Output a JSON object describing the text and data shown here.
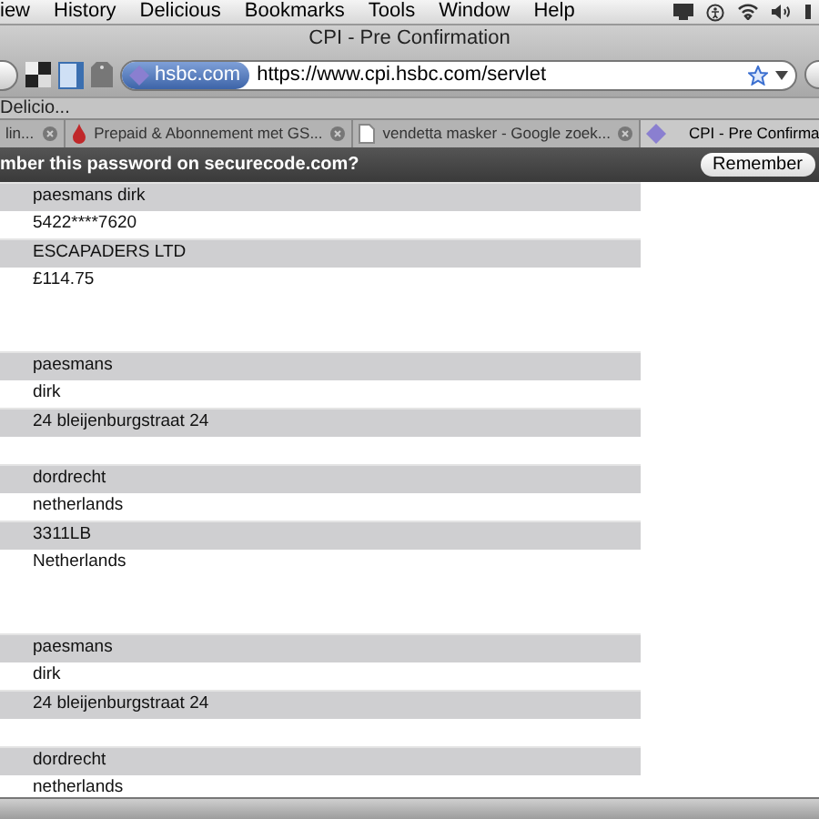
{
  "menu_bar": {
    "items": [
      "iew",
      "History",
      "Delicious",
      "Bookmarks",
      "Tools",
      "Window",
      "Help"
    ]
  },
  "window": {
    "title": "CPI - Pre Confirmation"
  },
  "toolbar": {
    "site_badge": "hsbc.com",
    "url": "https://www.cpi.hsbc.com/servlet"
  },
  "bookmarks_bar": {
    "items": [
      "Delicio..."
    ]
  },
  "tabs": [
    {
      "label": "lin...",
      "selected": false,
      "kind": "none"
    },
    {
      "label": "Prepaid & Abonnement met GS...",
      "selected": false,
      "kind": "drop"
    },
    {
      "label": "vendetta masker - Google zoek...",
      "selected": false,
      "kind": "page"
    },
    {
      "label": "CPI - Pre Confirma",
      "selected": true,
      "kind": "diamond"
    }
  ],
  "notification": {
    "message": "mber this password on securecode.com?",
    "button": "Remember"
  },
  "rows": [
    {
      "shaded": true,
      "text": "paesmans dirk"
    },
    {
      "shaded": false,
      "text": "5422****7620"
    },
    {
      "shaded": true,
      "text": "ESCAPADERS LTD"
    },
    {
      "shaded": false,
      "text": "£114.75"
    },
    {
      "shaded": false
    },
    {
      "shaded": false
    },
    {
      "shaded": true,
      "text": "paesmans"
    },
    {
      "shaded": false,
      "text": "dirk"
    },
    {
      "shaded": true,
      "text": "24 bleijenburgstraat 24"
    },
    {
      "shaded": false
    },
    {
      "shaded": true,
      "text": "dordrecht"
    },
    {
      "shaded": false,
      "text": "netherlands"
    },
    {
      "shaded": true,
      "text": "3311LB"
    },
    {
      "shaded": false,
      "text": "Netherlands"
    },
    {
      "shaded": false
    },
    {
      "shaded": false
    },
    {
      "shaded": true,
      "text": "paesmans"
    },
    {
      "shaded": false,
      "text": "dirk"
    },
    {
      "shaded": true,
      "text": "24 bleijenburgstraat 24"
    },
    {
      "shaded": false
    },
    {
      "shaded": true,
      "text": "dordrecht"
    },
    {
      "shaded": false,
      "text": "netherlands"
    }
  ]
}
